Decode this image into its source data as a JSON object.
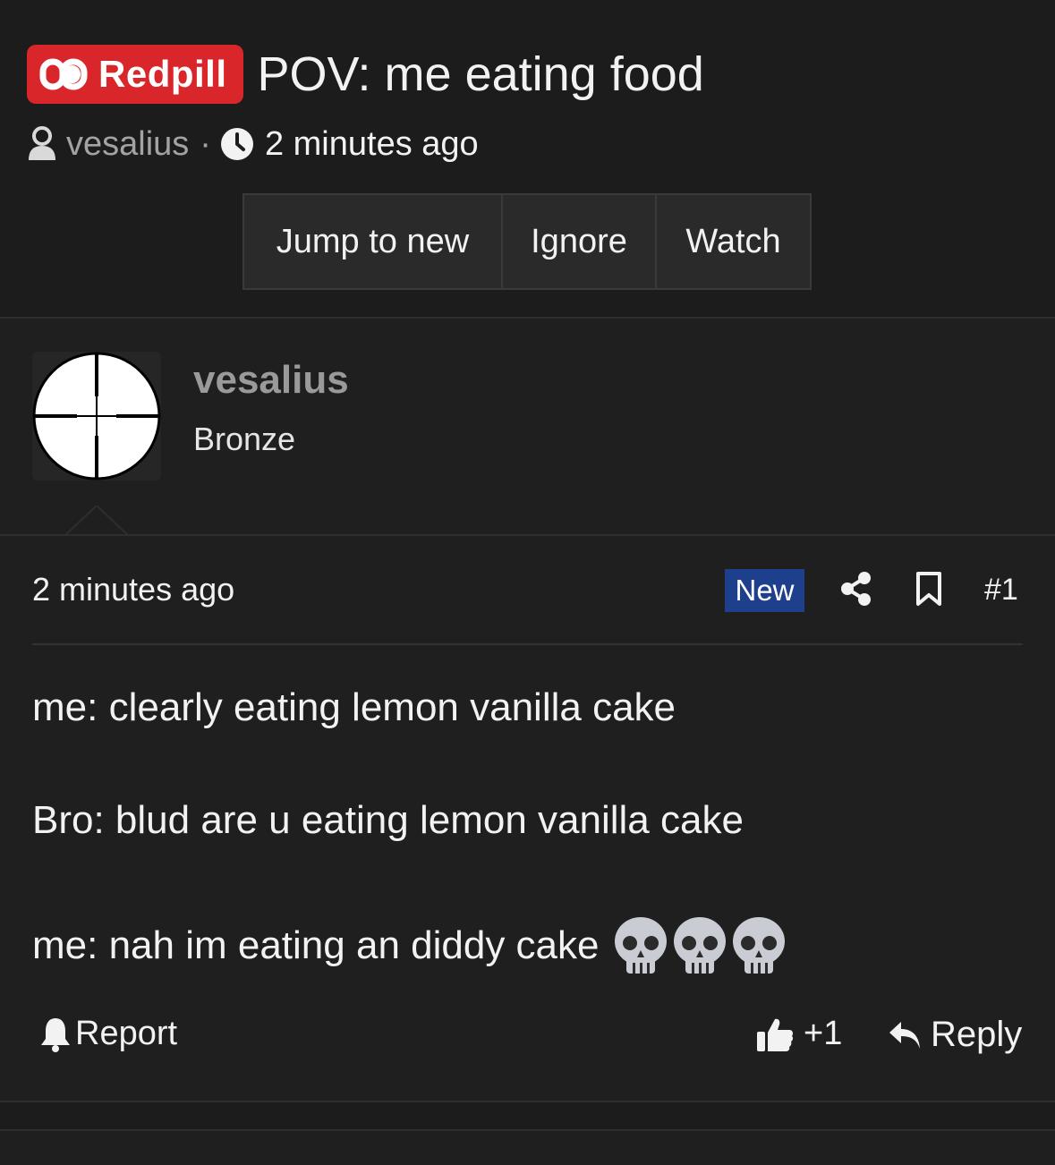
{
  "thread": {
    "prefix": "Redpill",
    "title": "POV: me eating food",
    "author": "vesalius",
    "separator": "·",
    "time": "2 minutes ago"
  },
  "actions": {
    "jump": "Jump to new",
    "ignore": "Ignore",
    "watch": "Watch"
  },
  "post": {
    "author": "vesalius",
    "user_title": "Bronze",
    "time": "2 minutes ago",
    "new_badge": "New",
    "number": "#1",
    "lines": [
      "me: clearly eating lemon vanilla cake",
      "Bro: blud are u eating lemon vanilla cake",
      "me: nah im eating an diddy cake"
    ],
    "emoji_count": 3,
    "report_label": "Report",
    "like_label": "+1",
    "reply_label": "Reply"
  },
  "colors": {
    "background": "#1c1c1c",
    "prefix_badge": "#d8262b",
    "new_badge": "#1e3f8c",
    "muted_text": "#a3a3a3"
  },
  "icons": [
    "pill-icon",
    "user-icon",
    "clock-icon",
    "crosshair-avatar",
    "share-icon",
    "bookmark-icon",
    "skull-icon",
    "bell-icon",
    "thumbs-up-icon",
    "reply-icon"
  ]
}
